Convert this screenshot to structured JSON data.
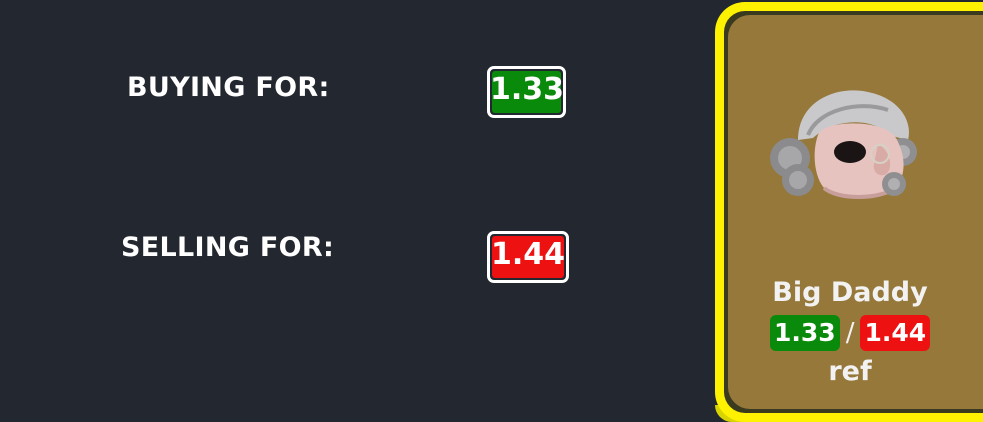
{
  "trade": {
    "buy_label": "BUYING FOR:",
    "buy_price": "1.33",
    "sell_label": "SELLING FOR:",
    "sell_price": "1.44"
  },
  "item": {
    "name": "Big Daddy",
    "buy_price": "1.33",
    "separator": "/",
    "sell_price": "1.44",
    "unit": "ref",
    "icon": "powdered-wig-mask-icon"
  },
  "colors": {
    "background": "#23272f",
    "buy": "#0a8a0a",
    "sell": "#ee1111",
    "card_border": "#fff200",
    "card_fill": "#95783a"
  }
}
